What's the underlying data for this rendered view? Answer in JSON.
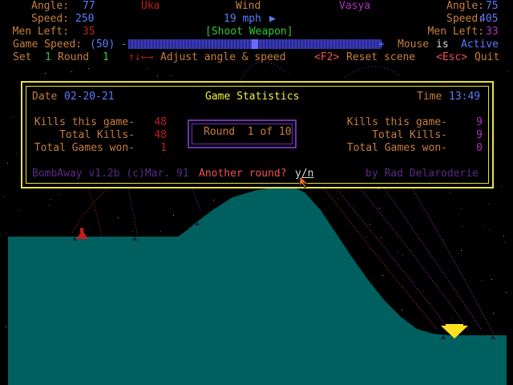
{
  "hud": {
    "left": {
      "angle_label": "Angle:",
      "angle": "77",
      "speed_label": "Speed:",
      "speed": "250",
      "men_label": "Men Left:",
      "men": "35",
      "player": "Uka"
    },
    "right": {
      "angle_label": "Angle:",
      "angle": "75",
      "speed_label": "Speed:",
      "speed": "405",
      "men_label": "Men Left:",
      "men": "33",
      "player": "Vasya"
    },
    "wind_label": "Wind",
    "wind_value": "19 mph",
    "wind_arrow": "▶",
    "weapon": "[Shoot Weapon]",
    "game_speed_label": "Game Speed:",
    "game_speed_value": "(50)",
    "game_speed_level": 0.5,
    "slider_minus": "-",
    "slider_plus": "+",
    "mouse_label": "Mouse",
    "mouse_is": "is",
    "mouse_state": "Active",
    "set_label": "Set",
    "set_value": "1",
    "round_label": "Round",
    "round_value": "1",
    "adjust_keys": "↑↓←→",
    "adjust_text": "Adjust angle & speed",
    "reset_key": "<F2>",
    "reset_text": "Reset scene",
    "quit_key": "<Esc>",
    "quit_text": "Quit"
  },
  "dialog": {
    "date_label": "Date",
    "date": "02-20-21",
    "title": "Game Statistics",
    "time_label": "Time",
    "time": "13:49",
    "kills_game_label": "Kills this game-",
    "total_kills_label": "Total Kills-",
    "games_won_label": "Total Games won-",
    "left": {
      "kills_game": "48",
      "total_kills": "48",
      "games_won": "1"
    },
    "right": {
      "kills_game": "9",
      "total_kills": "9",
      "games_won": "0"
    },
    "round_text": "Round  1 of 10",
    "credit": "BombAway v1.2b (c)Mar. 91",
    "prompt": "Another round?",
    "prompt_keys": "y/n",
    "author": "by Rad Delaroderie"
  },
  "colors": {
    "terrain": "#006060",
    "frame": "#e8e040",
    "left_player": "#c02020",
    "right_player": "#b030c0",
    "right_cannon": "#ffe020"
  }
}
